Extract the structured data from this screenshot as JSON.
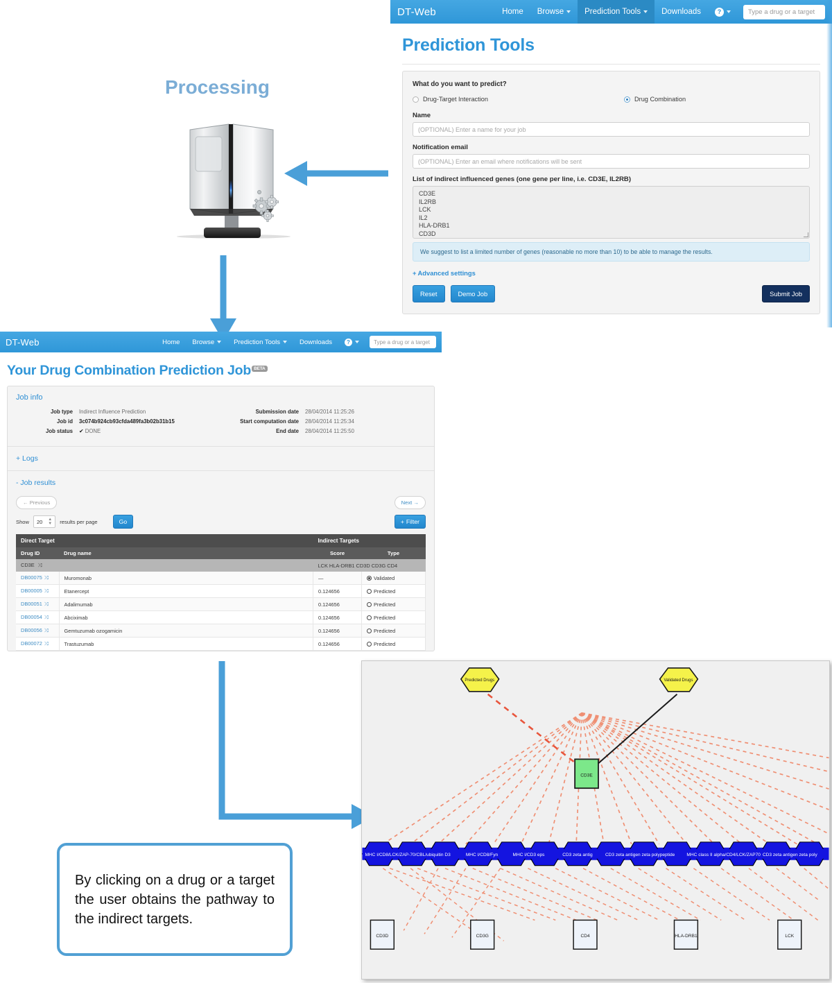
{
  "predict_window": {
    "navbar": {
      "brand": "DT-Web",
      "links": [
        {
          "label": "Home",
          "caret": false,
          "active": false
        },
        {
          "label": "Browse",
          "caret": true,
          "active": false
        },
        {
          "label": "Prediction Tools",
          "caret": true,
          "active": true
        },
        {
          "label": "Downloads",
          "caret": false,
          "active": false
        }
      ],
      "help_glyph": "?",
      "search_placeholder": "Type a drug or a target"
    },
    "page_title": "Prediction Tools",
    "form": {
      "question": "What do you want to predict?",
      "options": [
        {
          "label": "Drug-Target Interaction",
          "selected": false
        },
        {
          "label": "Drug Combination",
          "selected": true
        }
      ],
      "name_label": "Name",
      "name_placeholder": "(OPTIONAL) Enter a name for your job",
      "email_label": "Notification email",
      "email_placeholder": "(OPTIONAL) Enter an email where notifications will be sent",
      "genes_label": "List of indirect influenced genes (one gene per line, i.e. CD3E, IL2RB)",
      "genes_value": "CD3E\nIL2RB\nLCK\nIL2\nHLA-DRB1\nCD3D",
      "hint": "We suggest to list a limited number of genes (reasonable no more than 10) to be able to manage the results.",
      "advanced_label": "Advanced settings",
      "advanced_plus": "+",
      "reset_label": "Reset",
      "demo_label": "Demo Job",
      "submit_label": "Submit Job"
    }
  },
  "job_window": {
    "navbar": {
      "brand": "DT-Web",
      "links": [
        {
          "label": "Home",
          "caret": false,
          "active": false
        },
        {
          "label": "Browse",
          "caret": true,
          "active": false
        },
        {
          "label": "Prediction Tools",
          "caret": true,
          "active": false
        },
        {
          "label": "Downloads",
          "caret": false,
          "active": false
        }
      ],
      "help_glyph": "?",
      "search_placeholder": "Type a drug or a target"
    },
    "page_title": "Your Drug Combination Prediction Job",
    "beta_badge": "BETA",
    "job_info": {
      "heading": "Job info",
      "keys_left": [
        "Job type",
        "Job id",
        "Job status"
      ],
      "vals_left": [
        "Indirect Influence Prediction",
        "3c074b924cb93cfda489fa3b02b31b15",
        "DONE"
      ],
      "status_check": "✔",
      "keys_right": [
        "Submission date",
        "Start computation date",
        "End date"
      ],
      "vals_right": [
        "28/04/2014 11:25:26",
        "28/04/2014 11:25:34",
        "28/04/2014 11:25:50"
      ]
    },
    "logs_label": "+ Logs",
    "results_label": "- Job results",
    "pager": {
      "previous": "← Previous",
      "next": "Next →"
    },
    "show_row": {
      "show": "Show",
      "page_size": "20",
      "suffix": "results per page",
      "go": "Go",
      "filter": "Filter",
      "filter_plus": "+"
    },
    "table": {
      "group_headers": [
        "Direct Target",
        "Indirect Targets"
      ],
      "sub_headers": [
        "Drug ID",
        "Drug name",
        "Score",
        "Type"
      ],
      "group_row": {
        "target": "CD3E",
        "shuffle": "⤨",
        "indirect": "LCK HLA-DRB1 CD3D CD3G CD4"
      },
      "rows": [
        {
          "drug_id": "DB00075",
          "drug_name": "Muromonab",
          "score": "—",
          "type": "Validated"
        },
        {
          "drug_id": "DB00005",
          "drug_name": "Etanercept",
          "score": "0.124656",
          "type": "Predicted"
        },
        {
          "drug_id": "DB00051",
          "drug_name": "Adalimumab",
          "score": "0.124656",
          "type": "Predicted"
        },
        {
          "drug_id": "DB00054",
          "drug_name": "Abciximab",
          "score": "0.124656",
          "type": "Predicted"
        },
        {
          "drug_id": "DB00056",
          "drug_name": "Gemtuzumab ozogamicin",
          "score": "0.124656",
          "type": "Predicted"
        },
        {
          "drug_id": "DB00072",
          "drug_name": "Trastuzumab",
          "score": "0.124656",
          "type": "Predicted"
        }
      ]
    }
  },
  "processing": {
    "title": "Processing"
  },
  "graph": {
    "predicted_drugs_label": "Predicted Drugs",
    "validated_drugs_label": "Validated Drugs",
    "center_node": "CD3E",
    "band_labels": [
      "MHC I/CD8/LCK/ZAP-70/CBL/ubiquitin D3",
      "MHC I/CD8/Fyn",
      "MHC I/CD3 eps",
      "CD3 zeta antig",
      "CD3 zeta antigen zeta polypeptide",
      "MHC class II alpha/CD4/LCK/ZAP70",
      "CD3 zeta antigen zeta poly"
    ],
    "bottom_nodes": [
      "CD3D",
      "CD3G",
      "CD4",
      "HLA-DRB1",
      "LCK"
    ],
    "colors": {
      "hex_yellow": "#f5f24a",
      "center_green": "#7ce88a",
      "band_blue": "#1414e0",
      "dashed_red": "#e8553c",
      "dashed_orange": "#ef8f73"
    }
  },
  "callout": {
    "text": "By clicking on a drug or a target the user obtains the pathway to the indirect targets."
  },
  "accent": {
    "navbar_blue": "#3ba5e0",
    "arrow_blue": "#4a9fd8",
    "title_blue": "#2f95d8"
  }
}
